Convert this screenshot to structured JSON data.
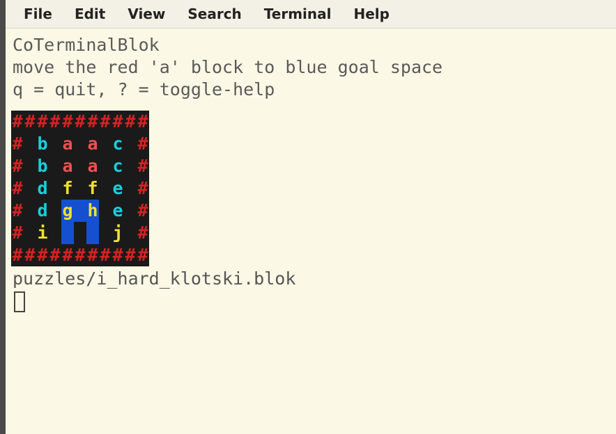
{
  "menubar": {
    "items": [
      {
        "label": "File"
      },
      {
        "label": "Edit"
      },
      {
        "label": "View"
      },
      {
        "label": "Search"
      },
      {
        "label": "Terminal"
      },
      {
        "label": "Help"
      }
    ]
  },
  "terminal": {
    "title": "CoTerminalBlok",
    "instruction": "move the red 'a' block to blue goal space",
    "help_line": "q = quit,  ? = toggle-help",
    "file_path": "puzzles/i_hard_klotski.blok"
  },
  "grid": {
    "cols": 11,
    "cells": [
      [
        "#",
        "w",
        0
      ],
      [
        "#",
        "w",
        0
      ],
      [
        "#",
        "w",
        0
      ],
      [
        "#",
        "w",
        0
      ],
      [
        "#",
        "w",
        0
      ],
      [
        "#",
        "w",
        0
      ],
      [
        "#",
        "w",
        0
      ],
      [
        "#",
        "w",
        0
      ],
      [
        "#",
        "w",
        0
      ],
      [
        "#",
        "w",
        0
      ],
      [
        "#",
        "w",
        0
      ],
      [
        "#",
        "w",
        0
      ],
      [
        " ",
        " ",
        0
      ],
      [
        "b",
        "c",
        0
      ],
      [
        " ",
        " ",
        0
      ],
      [
        "a",
        "r",
        0
      ],
      [
        " ",
        " ",
        0
      ],
      [
        "a",
        "r",
        0
      ],
      [
        " ",
        " ",
        0
      ],
      [
        "c",
        "c",
        0
      ],
      [
        " ",
        " ",
        0
      ],
      [
        "#",
        "w",
        0
      ],
      [
        "#",
        "w",
        0
      ],
      [
        " ",
        " ",
        0
      ],
      [
        "b",
        "c",
        0
      ],
      [
        " ",
        " ",
        0
      ],
      [
        "a",
        "r",
        0
      ],
      [
        " ",
        " ",
        0
      ],
      [
        "a",
        "r",
        0
      ],
      [
        " ",
        " ",
        0
      ],
      [
        "c",
        "c",
        0
      ],
      [
        " ",
        " ",
        0
      ],
      [
        "#",
        "w",
        0
      ],
      [
        "#",
        "w",
        0
      ],
      [
        " ",
        " ",
        0
      ],
      [
        "d",
        "c",
        0
      ],
      [
        " ",
        " ",
        0
      ],
      [
        "f",
        "y",
        0
      ],
      [
        " ",
        " ",
        0
      ],
      [
        "f",
        "y",
        0
      ],
      [
        " ",
        " ",
        0
      ],
      [
        "e",
        "c",
        0
      ],
      [
        " ",
        " ",
        0
      ],
      [
        "#",
        "w",
        0
      ],
      [
        "#",
        "w",
        0
      ],
      [
        " ",
        " ",
        0
      ],
      [
        "d",
        "c",
        0
      ],
      [
        " ",
        " ",
        0
      ],
      [
        "g",
        "y",
        1
      ],
      [
        " ",
        " ",
        1
      ],
      [
        "h",
        "y",
        1
      ],
      [
        " ",
        " ",
        0
      ],
      [
        "e",
        "c",
        0
      ],
      [
        " ",
        " ",
        0
      ],
      [
        "#",
        "w",
        0
      ],
      [
        "#",
        "w",
        0
      ],
      [
        " ",
        " ",
        0
      ],
      [
        "i",
        "y",
        0
      ],
      [
        " ",
        " ",
        0
      ],
      [
        " ",
        " ",
        1
      ],
      [
        " ",
        " ",
        0
      ],
      [
        " ",
        " ",
        1
      ],
      [
        " ",
        " ",
        0
      ],
      [
        "j",
        "y",
        0
      ],
      [
        " ",
        " ",
        0
      ],
      [
        "#",
        "w",
        0
      ],
      [
        "#",
        "w",
        0
      ],
      [
        "#",
        "w",
        0
      ],
      [
        "#",
        "w",
        0
      ],
      [
        "#",
        "w",
        0
      ],
      [
        "#",
        "w",
        0
      ],
      [
        "#",
        "w",
        0
      ],
      [
        "#",
        "w",
        0
      ],
      [
        "#",
        "w",
        0
      ],
      [
        "#",
        "w",
        0
      ],
      [
        "#",
        "w",
        0
      ],
      [
        "#",
        "w",
        0
      ]
    ]
  },
  "color_map": {
    "w": "wall",
    "c": "cyan",
    "r": "red",
    "y": "yellow",
    " ": ""
  }
}
